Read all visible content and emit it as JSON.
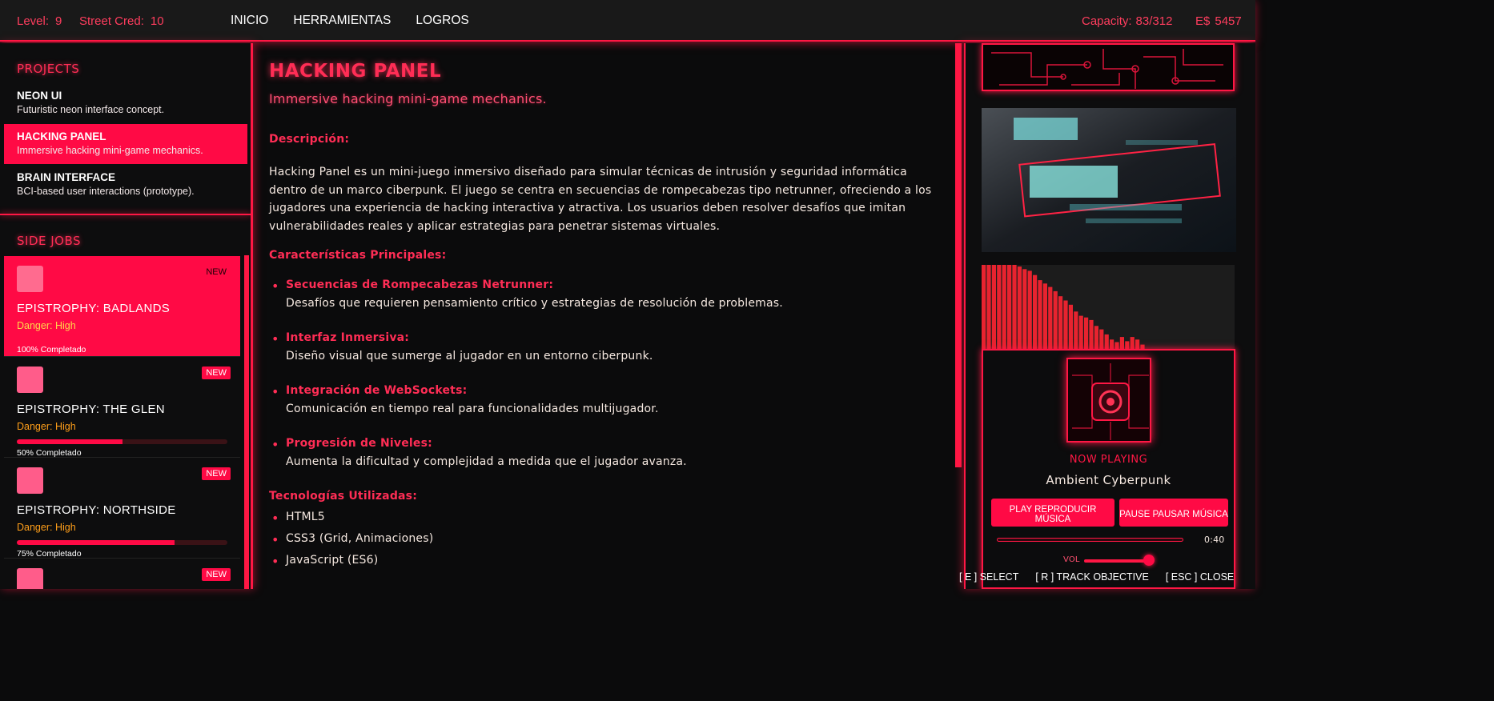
{
  "topbar": {
    "level_label": "Level:",
    "level_value": "9",
    "cred_label": "Street Cred:",
    "cred_value": "10",
    "nav": [
      "INICIO",
      "HERRAMIENTAS",
      "LOGROS"
    ],
    "capacity_label": "Capacity:",
    "capacity_value": "83/312",
    "money_label": "E$",
    "money_value": "5457"
  },
  "projects": {
    "title": "PROJECTS",
    "items": [
      {
        "title": "NEON UI",
        "desc": "Futuristic neon interface concept."
      },
      {
        "title": "HACKING PANEL",
        "desc": "Immersive hacking mini-game mechanics."
      },
      {
        "title": "BRAIN INTERFACE",
        "desc": "BCI-based user interactions (prototype)."
      }
    ]
  },
  "side_jobs": {
    "title": "SIDE JOBS",
    "items": [
      {
        "badge": "NEW",
        "title": "EPISTROPHY: BADLANDS",
        "danger": "Danger: High",
        "progress": 100,
        "progress_text": "100% Completado"
      },
      {
        "badge": "NEW",
        "title": "EPISTROPHY: THE GLEN",
        "danger": "Danger: High",
        "progress": 50,
        "progress_text": "50% Completado"
      },
      {
        "badge": "NEW",
        "title": "EPISTROPHY: NORTHSIDE",
        "danger": "Danger: High",
        "progress": 75,
        "progress_text": "75% Completado"
      },
      {
        "badge": "NEW"
      }
    ]
  },
  "main": {
    "title": "HACKING PANEL",
    "subtitle": "Immersive hacking mini-game mechanics.",
    "desc_heading": "Descripción:",
    "desc_text": "Hacking Panel es un mini-juego inmersivo diseñado para simular técnicas de intrusión y seguridad informática dentro de un marco ciberpunk. El juego se centra en secuencias de rompecabezas tipo netrunner, ofreciendo a los jugadores una experiencia de hacking interactiva y atractiva. Los usuarios deben resolver desafíos que imitan vulnerabilidades reales y aplicar estrategias para penetrar sistemas virtuales.",
    "features_heading": "Características Principales:",
    "features": [
      {
        "title": "Secuencias de Rompecabezas Netrunner:",
        "desc": "Desafíos que requieren pensamiento crítico y estrategias de resolución de problemas."
      },
      {
        "title": "Interfaz Inmersiva:",
        "desc": "Diseño visual que sumerge al jugador en un entorno ciberpunk."
      },
      {
        "title": "Integración de WebSockets:",
        "desc": "Comunicación en tiempo real para funcionalidades multijugador."
      },
      {
        "title": "Progresión de Niveles:",
        "desc": "Aumenta la dificultad y complejidad a medida que el jugador avanza."
      }
    ],
    "tech_heading": "Tecnologías Utilizadas:",
    "tech": [
      "HTML5",
      "CSS3 (Grid, Animaciones)",
      "JavaScript (ES6)"
    ]
  },
  "player": {
    "now_playing": "NOW PLAYING",
    "track": "Ambient Cyberpunk",
    "play_label": "PLAY REPRODUCIR MÚSICA",
    "pause_label": "PAUSE PAUSAR MÚSICA",
    "time": "0:40",
    "progress": 0,
    "vol_label": "VOL",
    "volume": 0.85,
    "equalizer_levels": [
      1.0,
      1.0,
      1.0,
      1.0,
      1.0,
      1.0,
      1.0,
      0.98,
      0.95,
      0.93,
      0.88,
      0.82,
      0.78,
      0.74,
      0.69,
      0.63,
      0.58,
      0.53,
      0.45,
      0.4,
      0.38,
      0.35,
      0.28,
      0.24,
      0.18,
      0.12,
      0.09,
      0.15,
      0.1,
      0.15,
      0.12,
      0.06
    ]
  },
  "hints": [
    "[ E ] SELECT",
    "[ R ] TRACK OBJECTIVE",
    "[ ESC ] CLOSE"
  ],
  "colors": {
    "accent": "#ff1744",
    "accent_fill": "#ff0a45",
    "danger": "#ff9f1a",
    "background": "#0b0b0c"
  }
}
